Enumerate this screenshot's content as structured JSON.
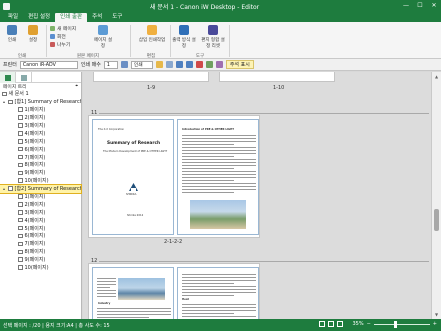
{
  "window": {
    "title": "새 문서 1 - Canon iW Desktop - Editor",
    "controls": [
      "—",
      "☐",
      "✕"
    ]
  },
  "menu": {
    "tabs": [
      "파일",
      "편집 설정",
      "인쇄 출판",
      "주석",
      "도구"
    ],
    "active_index": 2
  },
  "ribbon": {
    "big_buttons": [
      "인쇄",
      "설정",
      "새 페이지",
      "페이지 설정",
      "삽입 인쇄작업",
      "출력 방식 설정",
      "편지 형합 설정 리셋"
    ],
    "small_buttons": [
      "새 페이지",
      "회전",
      "나누기"
    ],
    "groups": [
      "인쇄",
      "원본 페이지",
      "편집",
      "도구"
    ]
  },
  "toolbar": {
    "printer_label": "프린터",
    "printer_value": "Canon iR-ADV",
    "copies_label": "인쇄 매수",
    "copies_value": "1",
    "mode_value": "인쇄",
    "annotation_label": "주석 표시"
  },
  "left_panel": {
    "title": "페이지 트리",
    "root": "새 문서 1",
    "group1_label": "[합1] Summary of Research",
    "group1_pages": [
      "1(페이지)",
      "2(페이지)",
      "3(페이지)",
      "4(페이지)",
      "5(페이지)",
      "6(페이지)",
      "7(페이지)",
      "8(페이지)",
      "9(페이지)",
      "10(페이지)"
    ],
    "group2_label": "[합2] Summary of Research",
    "group2_pages": [
      "1(페이지)",
      "2(페이지)",
      "3(페이지)",
      "4(페이지)",
      "5(페이지)",
      "6(페이지)",
      "7(페이지)",
      "8(페이지)",
      "9(페이지)",
      "10(페이지)"
    ]
  },
  "main": {
    "top_cards": [
      "1-9",
      "1-10"
    ],
    "section1_num": "11",
    "section1_label": "2-1-2-2",
    "section2_num": "12",
    "page_a": {
      "company": "The X.X Corporation",
      "title": "Summary of Research",
      "subtitle": "The Modern Development of PRE & OTHER LIGHT",
      "logo_text": "SHIRIKA",
      "footer": "Shirika 2012"
    },
    "page_b": {
      "title": "Introduction of PRE & OTHER LIGHT"
    },
    "page_c": {
      "heading": "Industry"
    },
    "page_d": {
      "heading": "Heat"
    }
  },
  "status": {
    "left_text": "선택 페이지 : /20 | 용지 크기:A4 | 총 사도 수: 15",
    "zoom": "35%"
  }
}
